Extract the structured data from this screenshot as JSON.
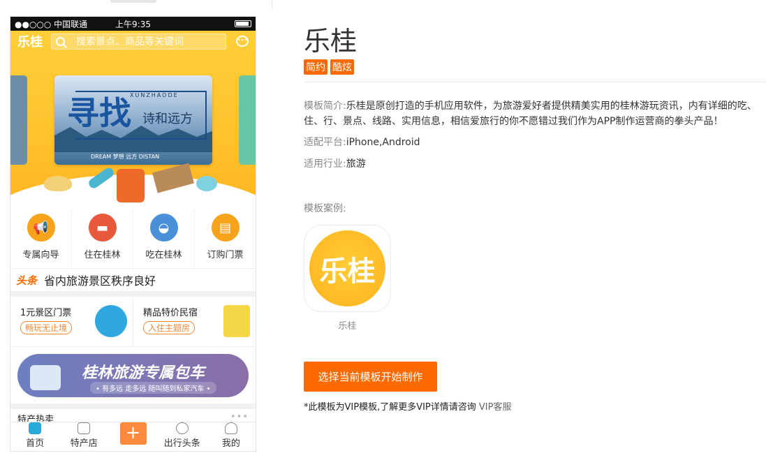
{
  "phone": {
    "status": {
      "carrier": "●●○○○ 中国联通",
      "time": "上午9:35"
    },
    "top": {
      "logo": "乐桂",
      "search_placeholder": "搜索景点、商品等关键词"
    },
    "banner": {
      "big": "寻找",
      "title": "诗和远方",
      "pinyin": "XUNZHAODE",
      "dream": "DREAM 梦想 远方 DISTAN"
    },
    "categories": [
      {
        "label": "专属向导",
        "color": "#f7a21b",
        "icon": "megaphone-icon"
      },
      {
        "label": "住在桂林",
        "color": "#e8583a",
        "icon": "bed-icon"
      },
      {
        "label": "吃在桂林",
        "color": "#4a90d9",
        "icon": "noodle-bowl-icon"
      },
      {
        "label": "订购门票",
        "color": "#f7a21b",
        "icon": "ticket-icon"
      }
    ],
    "news": {
      "tag": "头条",
      "headline": "省内旅游景区秩序良好"
    },
    "promos": [
      {
        "title": "1元景区门票",
        "sub": "畅玩无止境"
      },
      {
        "title": "精品特价民宿",
        "sub": "入住主题房"
      }
    ],
    "charter": {
      "title": "桂林旅游专属包车",
      "sub": "• 有多远 走多远 随叫随到私家汽车 •"
    },
    "hot": {
      "title": "特产热卖",
      "more": "•••"
    },
    "tabs": [
      {
        "label": "首页",
        "active": true
      },
      {
        "label": "特产店",
        "active": false
      },
      {
        "label": "+",
        "active": false
      },
      {
        "label": "出行头条",
        "active": false
      },
      {
        "label": "我的",
        "active": false
      }
    ]
  },
  "detail": {
    "title": "乐桂",
    "tags": [
      "简约",
      "酷炫"
    ],
    "intro_label": "模板简介:",
    "intro_text": "乐桂是原创打造的手机应用软件，为旅游爱好者提供精美实用的桂林游玩资讯，内有详细的吃、住、行、景点、线路、实用信息，相信爱旅行的你不愿错过我们作为APP制作运营商的拳头产品！",
    "platform_label": "适配平台:",
    "platform_value": "iPhone,Android",
    "industry_label": "适用行业:",
    "industry_value": "旅游",
    "case_label": "模板案例:",
    "app_icon_text": "乐桂",
    "app_name": "乐桂",
    "cta": "选择当前模板开始制作",
    "note_text": "*此模板为VIP模板,了解更多VIP详情请咨询 ",
    "note_link": "VIP客服",
    "accent": "#ff6a00"
  }
}
